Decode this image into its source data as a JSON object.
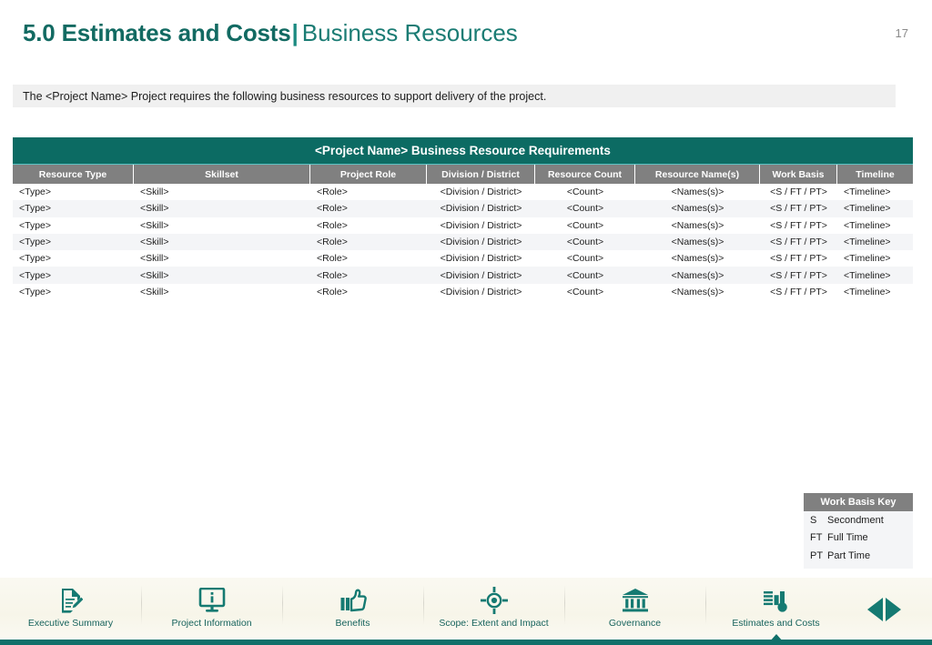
{
  "header": {
    "title_main": "5.0 Estimates and Costs",
    "title_divider": "|",
    "title_sub": "Business Resources",
    "page_number": "17"
  },
  "intro": {
    "text": "The <Project Name> Project requires the following business resources to support delivery of the project."
  },
  "table": {
    "caption": "<Project Name> Business Resource Requirements",
    "columns": [
      "Resource Type",
      "Skillset",
      "Project Role",
      "Division / District",
      "Resource Count",
      "Resource Name(s)",
      "Work Basis",
      "Timeline"
    ],
    "rows": [
      [
        "<Type>",
        "<Skill>",
        "<Role>",
        "<Division / District>",
        "<Count>",
        "<Names(s)>",
        "<S / FT / PT>",
        "<Timeline>"
      ],
      [
        "<Type>",
        "<Skill>",
        "<Role>",
        "<Division / District>",
        "<Count>",
        "<Names(s)>",
        "<S / FT / PT>",
        "<Timeline>"
      ],
      [
        "<Type>",
        "<Skill>",
        "<Role>",
        "<Division / District>",
        "<Count>",
        "<Names(s)>",
        "<S / FT / PT>",
        "<Timeline>"
      ],
      [
        "<Type>",
        "<Skill>",
        "<Role>",
        "<Division / District>",
        "<Count>",
        "<Names(s)>",
        "<S / FT / PT>",
        "<Timeline>"
      ],
      [
        "<Type>",
        "<Skill>",
        "<Role>",
        "<Division / District>",
        "<Count>",
        "<Names(s)>",
        "<S / FT / PT>",
        "<Timeline>"
      ],
      [
        "<Type>",
        "<Skill>",
        "<Role>",
        "<Division / District>",
        "<Count>",
        "<Names(s)>",
        "<S / FT / PT>",
        "<Timeline>"
      ],
      [
        "<Type>",
        "<Skill>",
        "<Role>",
        "<Division / District>",
        "<Count>",
        "<Names(s)>",
        "<S / FT / PT>",
        "<Timeline>"
      ]
    ]
  },
  "work_basis_key": {
    "title": "Work Basis Key",
    "entries": [
      {
        "abbr": "S",
        "meaning": "Secondment"
      },
      {
        "abbr": "FT",
        "meaning": "Full Time"
      },
      {
        "abbr": "PT",
        "meaning": "Part Time"
      }
    ]
  },
  "bottom_nav": {
    "items": [
      {
        "label": "Executive Summary",
        "icon": "document-edit-icon",
        "active": false
      },
      {
        "label": "Project Information",
        "icon": "monitor-info-icon",
        "active": false
      },
      {
        "label": "Benefits",
        "icon": "thumbs-up-icon",
        "active": false
      },
      {
        "label": "Scope: Extent and Impact",
        "icon": "target-crosshair-icon",
        "active": false
      },
      {
        "label": "Governance",
        "icon": "bank-columns-icon",
        "active": false
      },
      {
        "label": "Estimates and Costs",
        "icon": "bar-chart-icon",
        "active": true
      }
    ],
    "prev_icon": "arrow-left-icon",
    "next_icon": "arrow-right-icon"
  },
  "colors": {
    "teal_dark": "#0c6b63",
    "teal_title": "#126a62",
    "teal_sub": "#1b7c74",
    "header_gray": "#808080",
    "band_gray": "#f0f0f0",
    "row_alt": "#f4f5f7",
    "nav_bg": "#f7f5e9",
    "nav_strip": "#10706a"
  }
}
